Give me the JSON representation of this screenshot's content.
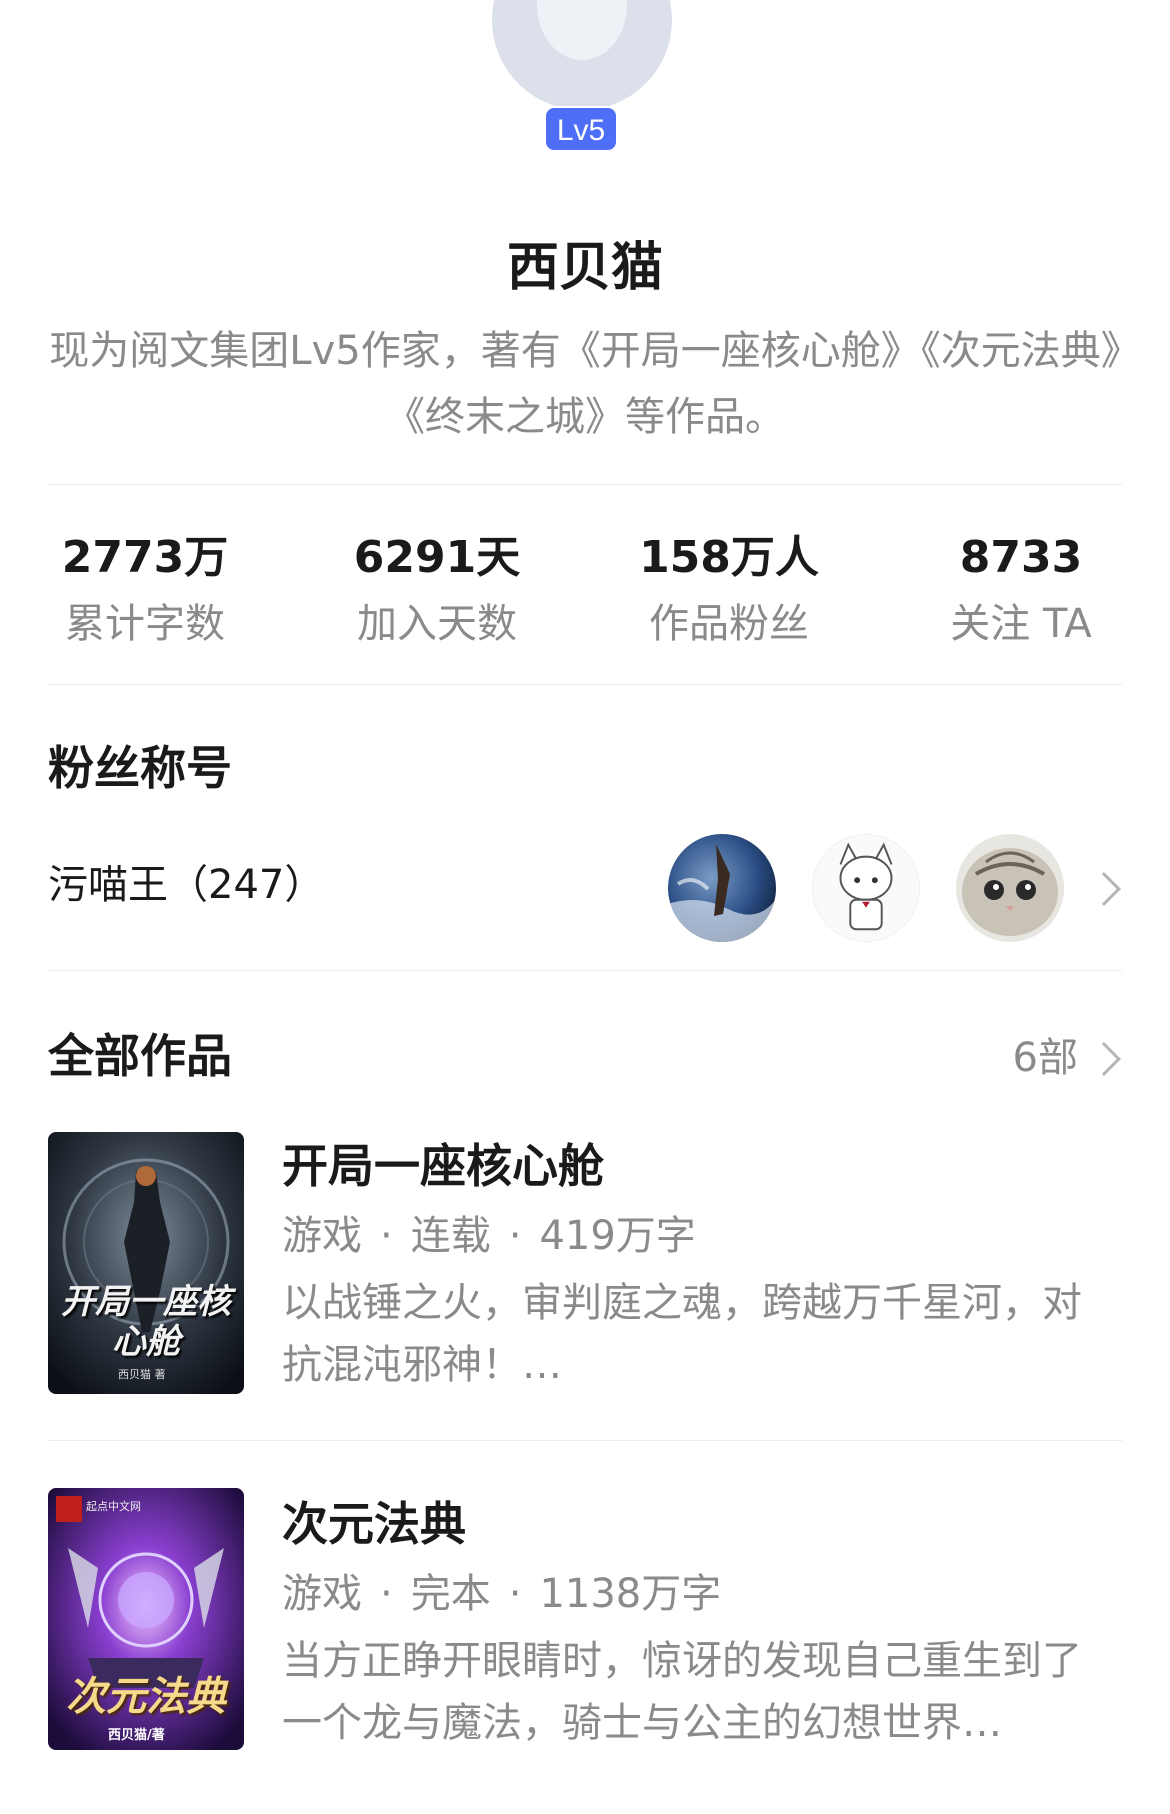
{
  "profile": {
    "level": "Lv5",
    "name": "西贝猫",
    "bio": "现为阅文集团Lv5作家，著有《开局一座核心舱》《次元法典》《终末之城》等作品。"
  },
  "stats": [
    {
      "value": "2773万",
      "label": "累计字数"
    },
    {
      "value": "6291天",
      "label": "加入天数"
    },
    {
      "value": "158万人",
      "label": "作品粉丝"
    },
    {
      "value": "8733",
      "label": "关注 TA"
    }
  ],
  "fan_section": {
    "title": "粉丝称号",
    "fan_title": "污喵王（247）"
  },
  "works_section": {
    "title": "全部作品",
    "count": "6部"
  },
  "books": [
    {
      "title": "开局一座核心舱",
      "genre": "游戏",
      "status": "连载",
      "words": "419万字",
      "description": "以战锤之火，审判庭之魂，跨越万千星河，对抗混沌邪神！…",
      "cover_text": "开局一座核心舱",
      "cover_author": "西贝猫 著"
    },
    {
      "title": "次元法典",
      "genre": "游戏",
      "status": "完本",
      "words": "1138万字",
      "description": "当方正睁开眼睛时，惊讶的发现自己重生到了一个龙与魔法，骑士与公主的幻想世界…",
      "cover_text": "次元法典",
      "cover_author": "西贝猫/著",
      "cover_publisher": "起点中文网"
    }
  ]
}
